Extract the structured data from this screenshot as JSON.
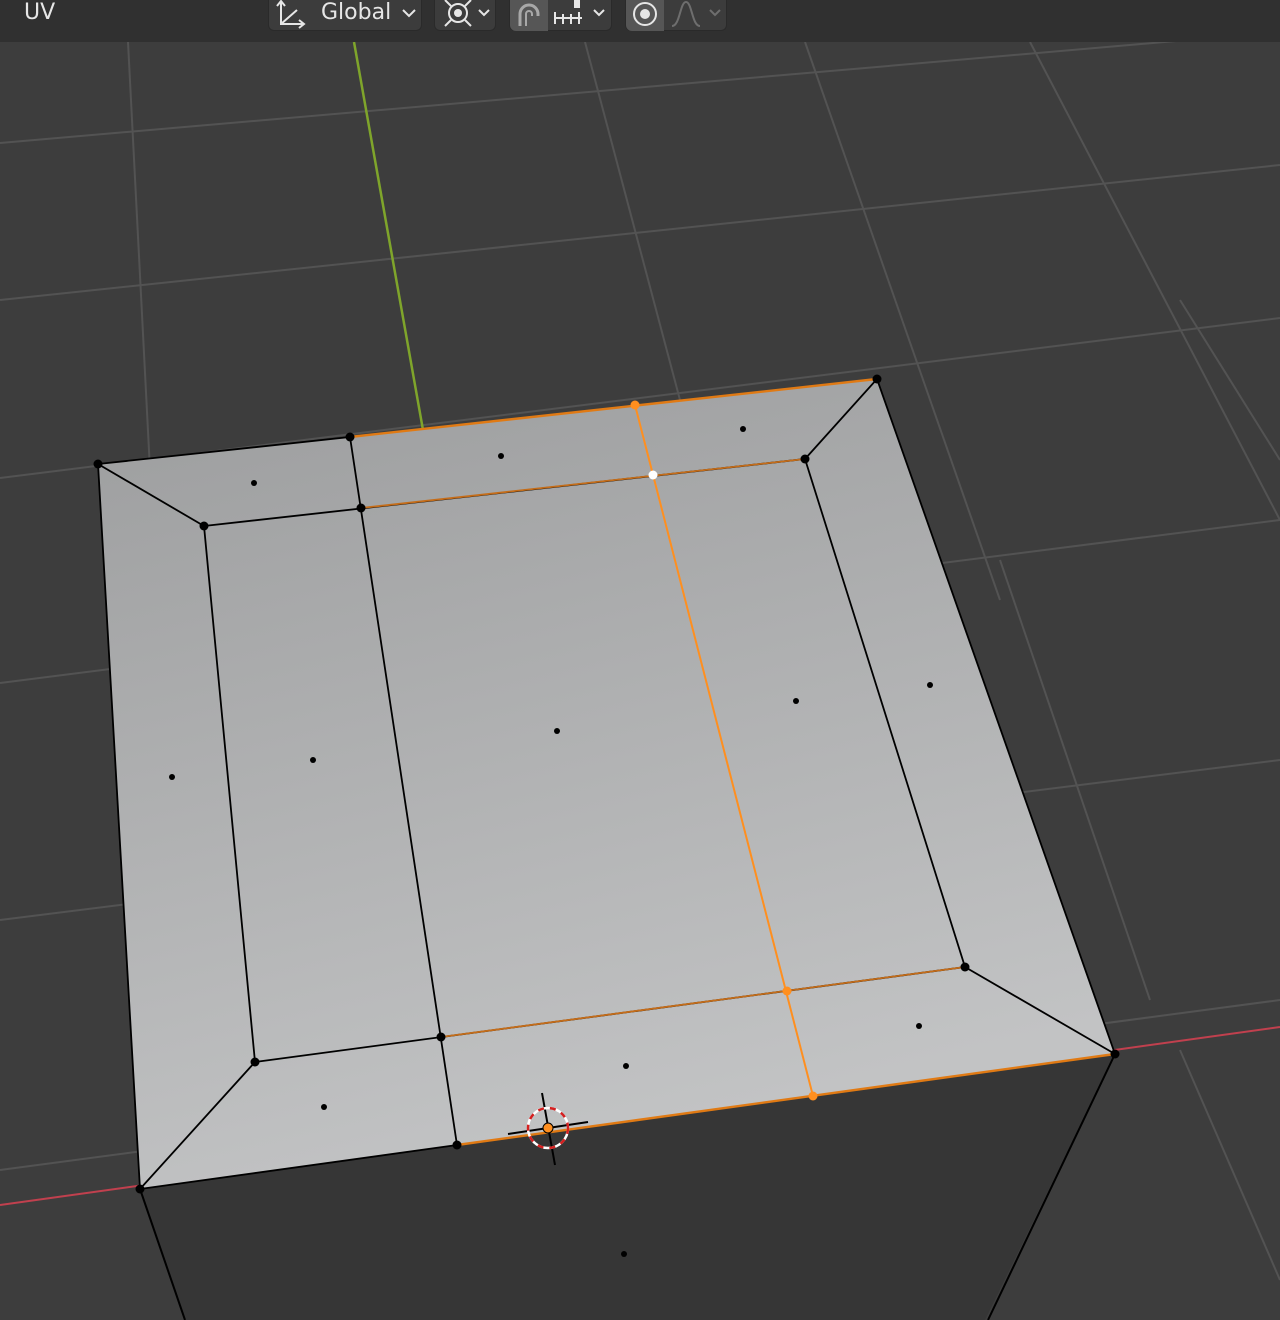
{
  "header": {
    "uv_menu_label": "UV",
    "transform_orientation": "Global",
    "pivot_icon": "pivot-point-icon",
    "snap_icon": "magnet-icon",
    "snap_target_icon": "snap-increment-icon",
    "proportional_icon": "proportional-editing-icon",
    "falloff_icon": "falloff-curve-icon"
  },
  "colors": {
    "viewport_bg": "#3d3d3d",
    "grid_line": "#535353",
    "x_axis": "#c1404e",
    "y_axis": "#7fa52b",
    "mesh_top": "#b4b5b6",
    "mesh_side": "#363636",
    "selected_edge": "#ff8f1f",
    "active_vertex": "#ffffff",
    "vertex": "#000000"
  }
}
